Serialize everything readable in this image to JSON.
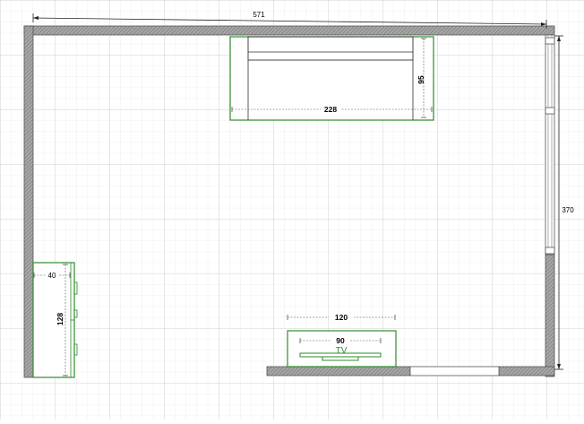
{
  "plan": {
    "width_label": "571",
    "height_label": "370",
    "wall_color": "#8c8c8c",
    "furniture_color": "#2e8b2e"
  },
  "sofa": {
    "width_label": "228",
    "depth_label": "95"
  },
  "cabinet": {
    "width_label": "40",
    "height_label": "128"
  },
  "tv_stand": {
    "width_label": "120"
  },
  "tv": {
    "width_label": "90",
    "label": "TV"
  }
}
